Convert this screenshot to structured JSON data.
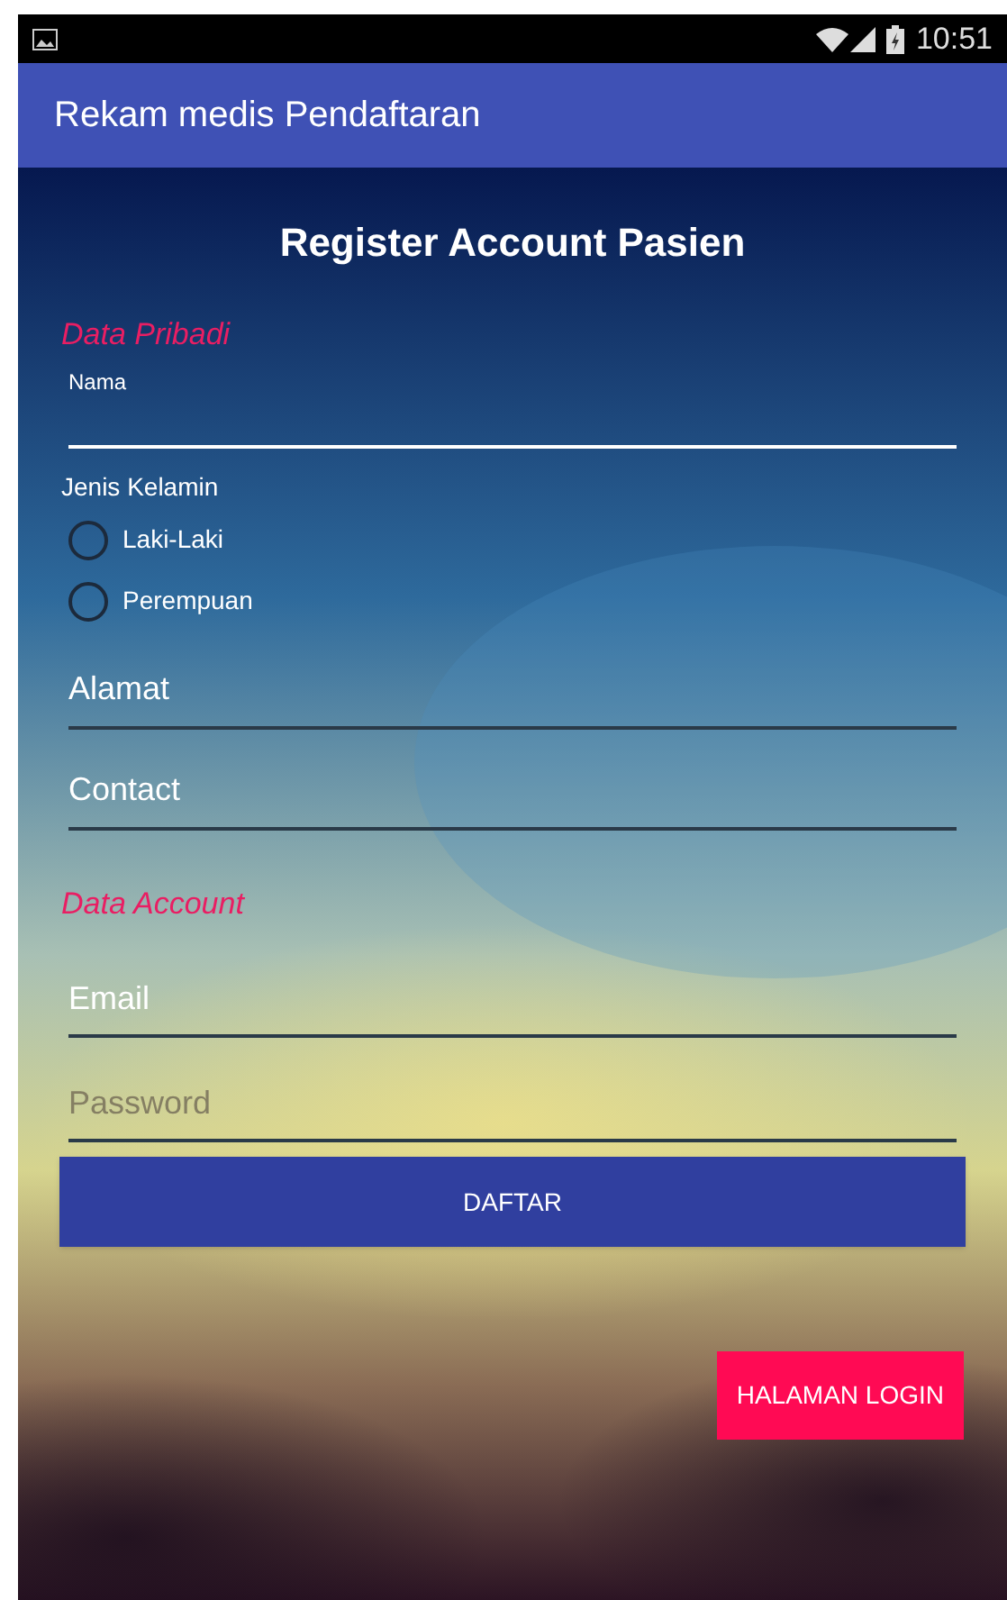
{
  "status_bar": {
    "time": "10:51"
  },
  "app_bar": {
    "title": "Rekam medis Pendaftaran"
  },
  "heading": "Register Account Pasien",
  "sections": [
    {
      "title": "Data Pribadi",
      "fields": [
        {
          "kind": "labeled",
          "label": "Nama",
          "focused": true
        },
        {
          "kind": "radio_group",
          "label": "Jenis Kelamin",
          "options": [
            {
              "label": "Laki-Laki",
              "selected": false
            },
            {
              "label": "Perempuan",
              "selected": false
            }
          ]
        },
        {
          "kind": "text",
          "placeholder": "Alamat",
          "focused": false
        },
        {
          "kind": "text",
          "placeholder": "Contact",
          "focused": false
        }
      ]
    },
    {
      "title": "Data Account",
      "fields": [
        {
          "kind": "text",
          "placeholder": "Email",
          "focused": false
        },
        {
          "kind": "password",
          "placeholder": "Password",
          "focused": false
        }
      ]
    }
  ],
  "buttons": [
    {
      "kind": "primary",
      "label": "DAFTAR"
    },
    {
      "kind": "accent",
      "label": "HALAMAN LOGIN"
    }
  ]
}
